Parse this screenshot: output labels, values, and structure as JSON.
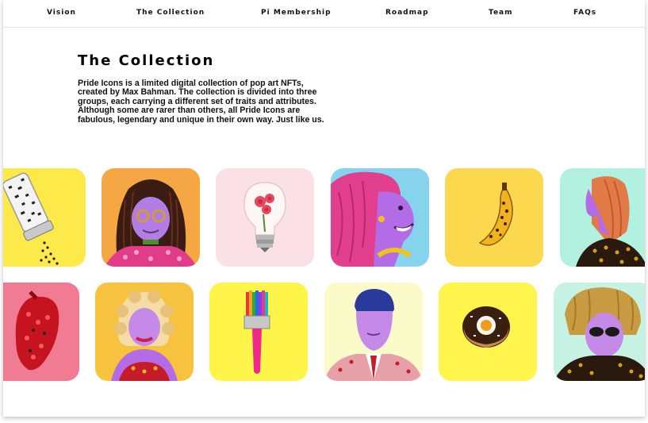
{
  "nav": {
    "items": [
      {
        "label": "Vision"
      },
      {
        "label": "The Collection"
      },
      {
        "label": "Pi Membership"
      },
      {
        "label": "Roadmap"
      },
      {
        "label": "Team"
      },
      {
        "label": "FAQs"
      }
    ]
  },
  "collection": {
    "title": "The Collection",
    "description": "Pride Icons is a limited digital collection of pop art NFTs, created by Max Bahman. The collection is divided into three groups, each carrying a different set of traits and attributes. Although some are rarer than others, all Pride Icons are fabulous, legendary and unique in their own way. Just like us."
  },
  "gallery": {
    "row1": [
      {
        "icon": "salt-shaker-art",
        "bg": "#fde94a"
      },
      {
        "icon": "dreadlocks-portrait-art",
        "bg": "#f4a742"
      },
      {
        "icon": "lightbulb-roses-art",
        "bg": "#fbe1e6"
      },
      {
        "icon": "pink-hair-diva-art",
        "bg": "#86d3ee"
      },
      {
        "icon": "leopard-banana-art",
        "bg": "#fcd84e"
      },
      {
        "icon": "red-hair-profile-art",
        "bg": "#b2f0df"
      }
    ],
    "row2": [
      {
        "icon": "glitter-heart-art",
        "bg": "#f17b93"
      },
      {
        "icon": "blonde-drag-queen-art",
        "bg": "#f7c33e"
      },
      {
        "icon": "paintbrush-art",
        "bg": "#fff44a"
      },
      {
        "icon": "suited-man-portrait-art",
        "bg": "#fafbc8"
      },
      {
        "icon": "donut-egg-art",
        "bg": "#fff54c"
      },
      {
        "icon": "gold-hair-sunglasses-art",
        "bg": "#c6f2e4"
      }
    ]
  }
}
